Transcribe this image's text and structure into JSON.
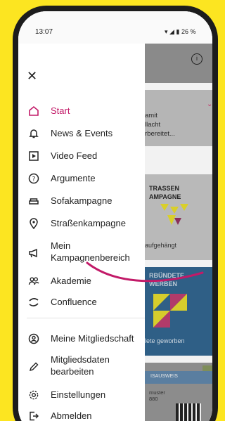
{
  "status_bar": {
    "time": "13:07",
    "battery": "26 %"
  },
  "drawer": {
    "items": [
      {
        "label": "Start",
        "icon": "home-icon",
        "active": true
      },
      {
        "label": "News & Events",
        "icon": "bell-icon"
      },
      {
        "label": "Video Feed",
        "icon": "video-icon"
      },
      {
        "label": "Argumente",
        "icon": "question-circle-icon"
      },
      {
        "label": "Sofakampagne",
        "icon": "sofa-icon"
      },
      {
        "label": "Straßenkampagne",
        "icon": "location-pin-icon"
      },
      {
        "label": "Mein\nKampagnenbereich",
        "icon": "megaphone-icon"
      },
      {
        "label": "Akademie",
        "icon": "people-icon"
      },
      {
        "label": "Confluence",
        "icon": "confluence-icon"
      },
      {
        "label": "Meine Mitgliedschaft",
        "icon": "member-icon"
      },
      {
        "label": "Mitgliedsdaten\nbearbeiten",
        "icon": "pencil-icon"
      },
      {
        "label": "Einstellungen",
        "icon": "settings-icon"
      },
      {
        "label": "Abmelden",
        "icon": "logout-icon"
      }
    ]
  },
  "background": {
    "card1_text": "amit\nllacht\nrbereitet...",
    "card2_title": "TRASSEN\nAMPAGNE",
    "card2_caption": "aufgehängt",
    "card3_title": "RBÜNDETE\nWERBEN",
    "card3_caption": "lete geworben",
    "card4_band": "ISAUSWEIS",
    "card4_text": "muster\n880"
  },
  "colors": {
    "accent": "#c21a68",
    "background_yellow": "#FCE521"
  }
}
